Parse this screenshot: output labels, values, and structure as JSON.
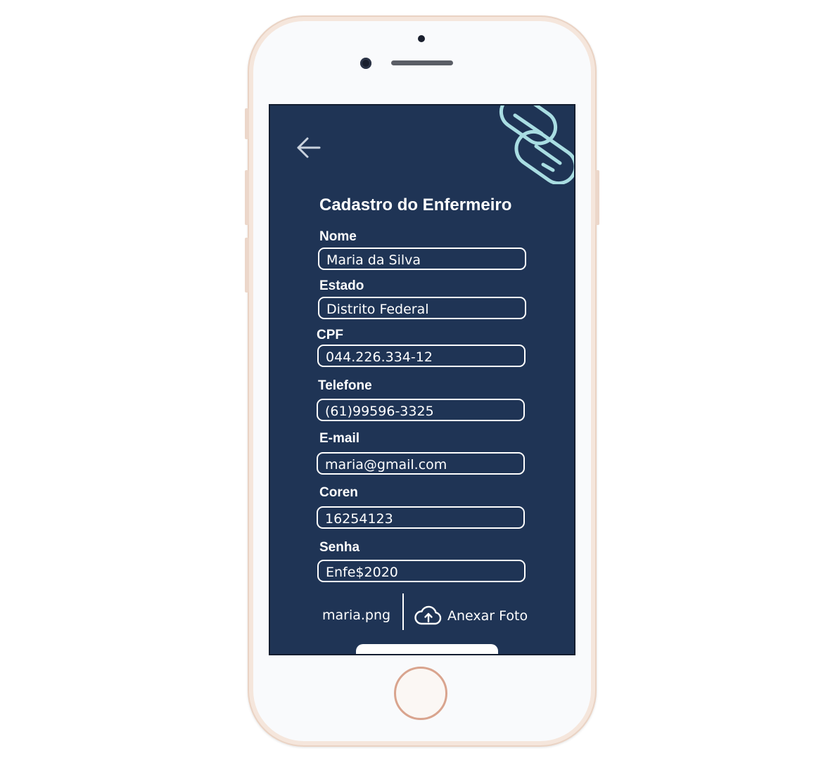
{
  "screen": {
    "title": "Cadastro do Enfermeiro",
    "fields": [
      {
        "label": "Nome",
        "value": "Maria da Silva"
      },
      {
        "label": "Estado",
        "value": "Distrito Federal"
      },
      {
        "label": "CPF",
        "value": "044.226.334-12"
      },
      {
        "label": "Telefone",
        "value": "(61)99596-3325"
      },
      {
        "label": "E-mail",
        "value": "maria@gmail.com"
      },
      {
        "label": "Coren",
        "value": "16254123"
      },
      {
        "label": "Senha",
        "value": "Enfe$2020"
      }
    ],
    "attachment": {
      "file_name": "maria.png",
      "button_label": "Anexar Foto"
    }
  },
  "icons": {
    "back": "arrow-left-icon",
    "decor": "pill-capsules-icon",
    "upload": "cloud-upload-icon"
  },
  "colors": {
    "screen_background": "#1f3455",
    "text": "#ffffff",
    "accent_decor": "#a9dde2",
    "phone_frame": "#f5e6dc",
    "home_button_ring": "#d9a48e"
  }
}
